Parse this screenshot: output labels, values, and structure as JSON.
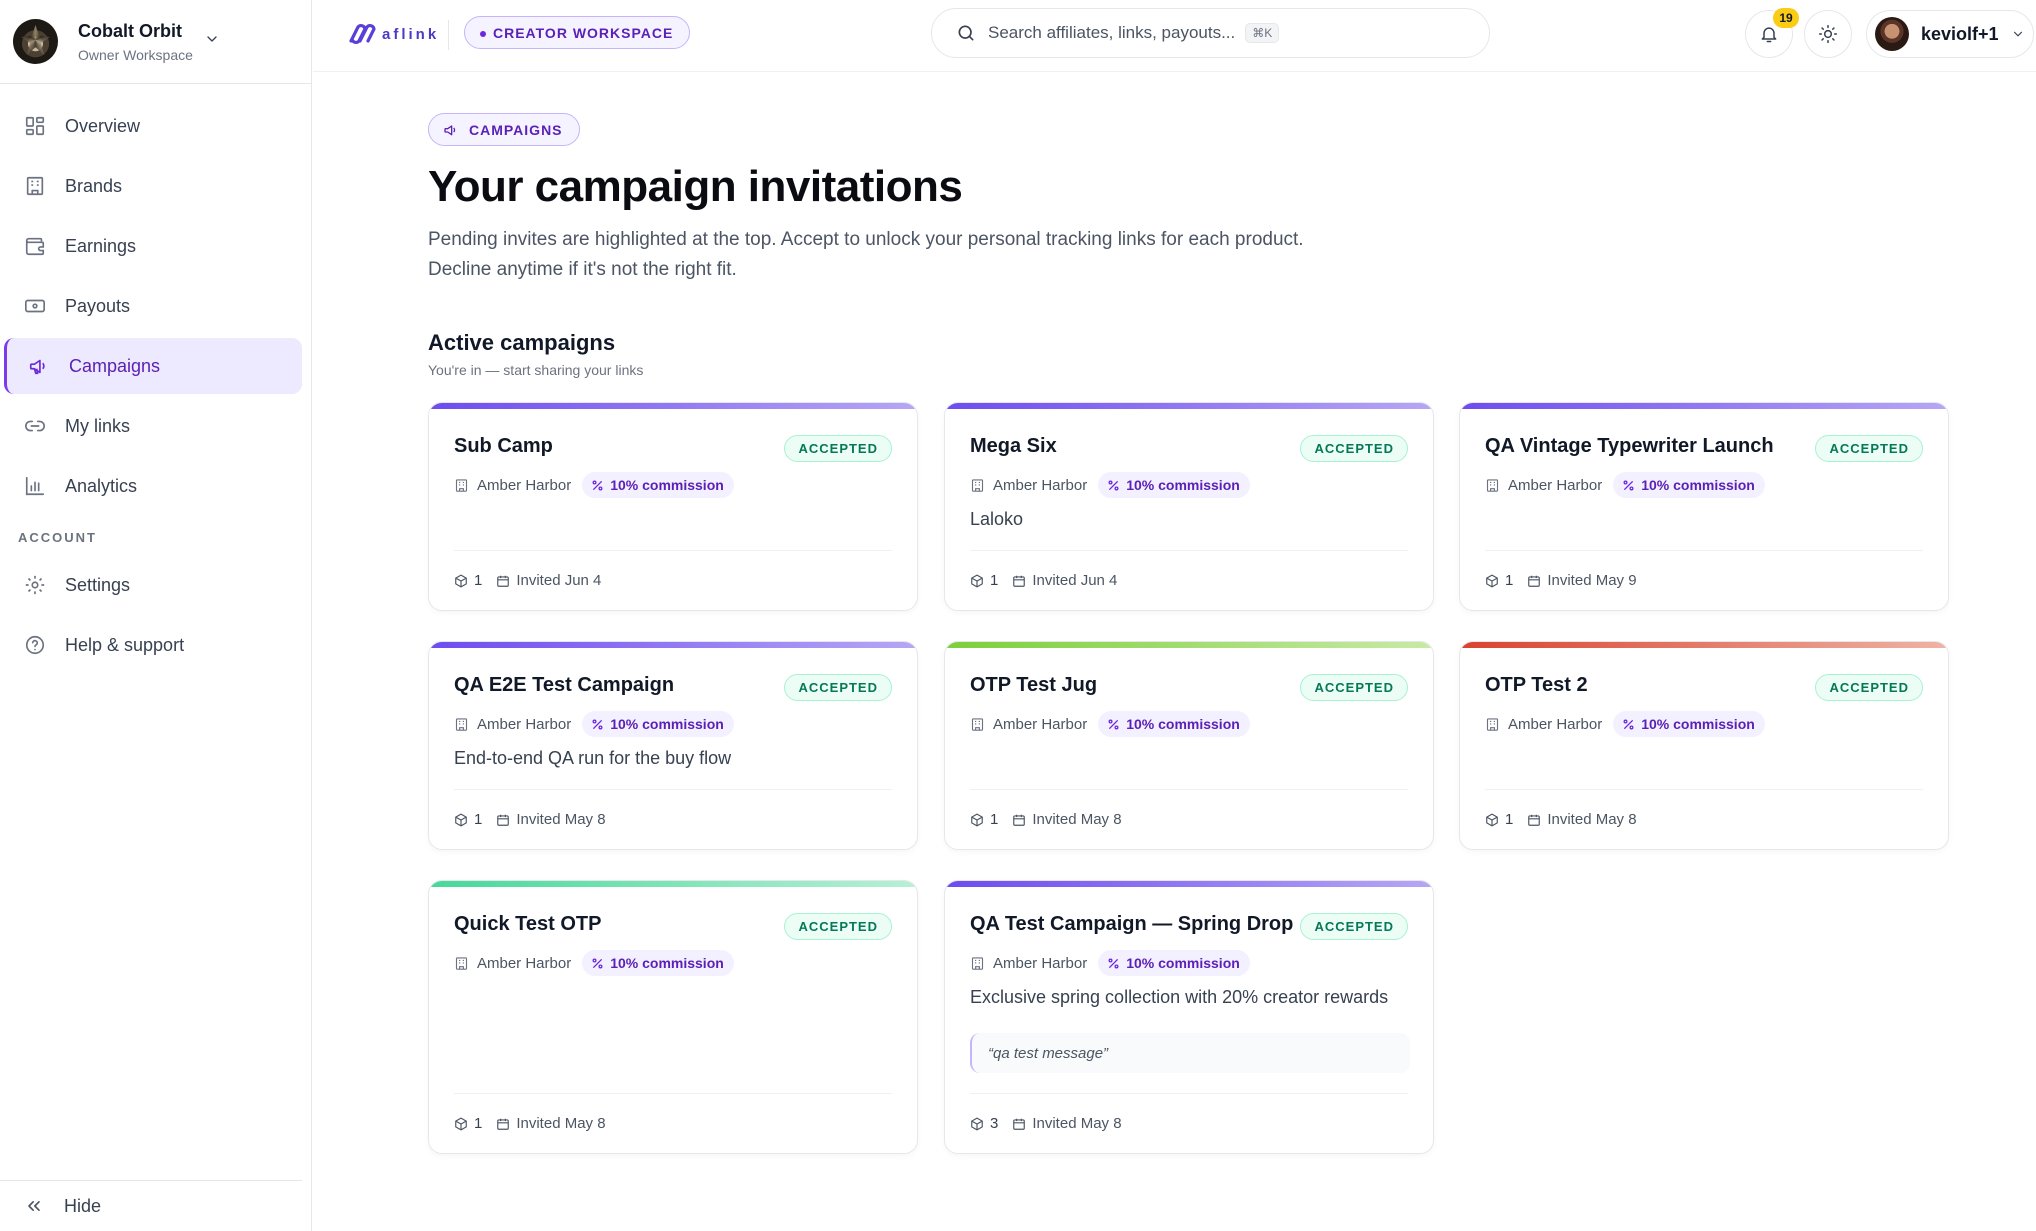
{
  "workspace": {
    "name": "Cobalt Orbit",
    "role": "Owner Workspace"
  },
  "nav": {
    "items": [
      {
        "label": "Overview",
        "icon": "grid-icon"
      },
      {
        "label": "Brands",
        "icon": "building-icon"
      },
      {
        "label": "Earnings",
        "icon": "wallet-icon"
      },
      {
        "label": "Payouts",
        "icon": "banknote-icon"
      },
      {
        "label": "Campaigns",
        "icon": "megaphone-icon",
        "active": true
      },
      {
        "label": "My links",
        "icon": "link-icon"
      },
      {
        "label": "Analytics",
        "icon": "bar-chart-icon"
      }
    ],
    "account_label": "ACCOUNT",
    "account_items": [
      {
        "label": "Settings",
        "icon": "gear-icon"
      },
      {
        "label": "Help & support",
        "icon": "help-circle-icon"
      }
    ],
    "hide_label": "Hide"
  },
  "topbar": {
    "brand": "aflink",
    "workspace_pill": "CREATOR WORKSPACE",
    "search_placeholder": "Search affiliates, links, payouts...",
    "search_shortcut": "⌘K",
    "notifications_count": "19",
    "user_name": "keviolf+1"
  },
  "page": {
    "section_pill": "CAMPAIGNS",
    "title": "Your campaign invitations",
    "description": "Pending invites are highlighted at the top. Accept to unlock your personal tracking links for each product. Decline anytime if it's not the right fit.",
    "active_title": "Active campaigns",
    "active_subtitle": "You're in — start sharing your links"
  },
  "colors": {
    "accent": "#6d28d9",
    "accepted_text": "#047857",
    "accepted_bg": "#ecfdf5"
  },
  "campaigns": [
    {
      "title": "Sub Camp",
      "status": "ACCEPTED",
      "brand": "Amber Harbor",
      "commission": "10% commission",
      "description": "",
      "message": "",
      "products": "1",
      "invited": "Invited Jun 4",
      "bar": "#6d4cf0,#b7a6f6"
    },
    {
      "title": "Mega Six",
      "status": "ACCEPTED",
      "brand": "Amber Harbor",
      "commission": "10% commission",
      "description": "Laloko",
      "message": "",
      "products": "1",
      "invited": "Invited Jun 4",
      "bar": "#6d4cf0,#b7a6f6"
    },
    {
      "title": "QA Vintage Typewriter Launch",
      "status": "ACCEPTED",
      "brand": "Amber Harbor",
      "commission": "10% commission",
      "description": "",
      "message": "",
      "products": "1",
      "invited": "Invited May 9",
      "bar": "#6d4cf0,#b7a6f6"
    },
    {
      "title": "QA E2E Test Campaign",
      "status": "ACCEPTED",
      "brand": "Amber Harbor",
      "commission": "10% commission",
      "description": "End-to-end QA run for the buy flow",
      "message": "",
      "products": "1",
      "invited": "Invited May 8",
      "bar": "#6d4cf0,#b7a6f6"
    },
    {
      "title": "OTP Test Jug",
      "status": "ACCEPTED",
      "brand": "Amber Harbor",
      "commission": "10% commission",
      "description": "",
      "message": "",
      "products": "1",
      "invited": "Invited May 8",
      "bar": "#7ccf3a,#c8eaa5"
    },
    {
      "title": "OTP Test 2",
      "status": "ACCEPTED",
      "brand": "Amber Harbor",
      "commission": "10% commission",
      "description": "",
      "message": "",
      "products": "1",
      "invited": "Invited May 8",
      "bar": "#d9432f,#efb3a5"
    },
    {
      "title": "Quick Test OTP",
      "status": "ACCEPTED",
      "brand": "Amber Harbor",
      "commission": "10% commission",
      "description": "",
      "message": "",
      "products": "1",
      "invited": "Invited May 8",
      "bar": "#47d89a,#b7f0d6"
    },
    {
      "title": "QA Test Campaign — Spring Drop",
      "status": "ACCEPTED",
      "brand": "Amber Harbor",
      "commission": "10% commission",
      "description": "Exclusive spring collection with 20% creator rewards",
      "message": "“qa test message”",
      "products": "3",
      "invited": "Invited May 8",
      "bar": "#6d4cf0,#b7a6f6"
    }
  ]
}
